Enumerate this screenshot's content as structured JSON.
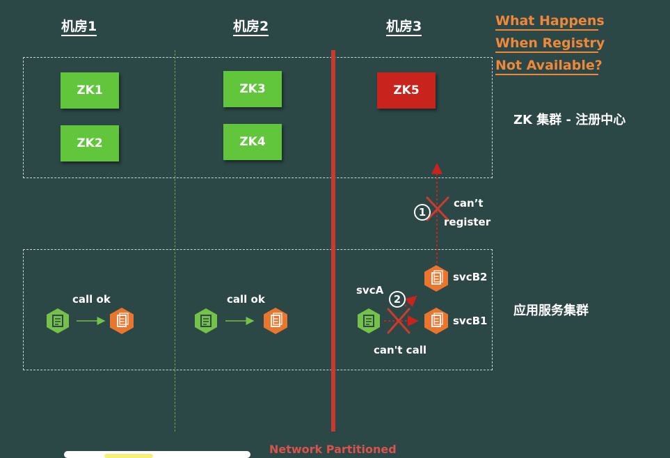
{
  "title": {
    "line1": "What Happens",
    "line2": "When Registry",
    "line3": "Not Available?"
  },
  "datacenters": [
    "机房1",
    "机房2",
    "机房3"
  ],
  "zk_nodes": [
    {
      "label": "ZK1",
      "status": "ok"
    },
    {
      "label": "ZK2",
      "status": "ok"
    },
    {
      "label": "ZK3",
      "status": "ok"
    },
    {
      "label": "ZK4",
      "status": "ok"
    },
    {
      "label": "ZK5",
      "status": "partitioned"
    }
  ],
  "zk_cluster_label": "ZK 集群 - 注册中心",
  "app_cluster_label": "应用服务集群",
  "calls": {
    "call_ok_1": "call ok",
    "call_ok_2": "call ok",
    "cant_call": "can't call",
    "cant_register_1": "can’t",
    "cant_register_2": "register"
  },
  "services": {
    "svcA": "svcA",
    "svcB1": "svcB1",
    "svcB2": "svcB2"
  },
  "steps": {
    "one": "1",
    "two": "2"
  },
  "partition_label": "Network Partitioned",
  "colors": {
    "background": "#2b4746",
    "zk_ok": "#62c63c",
    "zk_bad": "#c9231d",
    "title": "#f0883a",
    "partition": "#c63a30",
    "consumer": "#74c24a",
    "provider": "#e8762e",
    "cross": "#d03a2e"
  },
  "icons": {
    "consumer": "consumer-hexagon-icon",
    "provider": "provider-hexagon-icon"
  }
}
